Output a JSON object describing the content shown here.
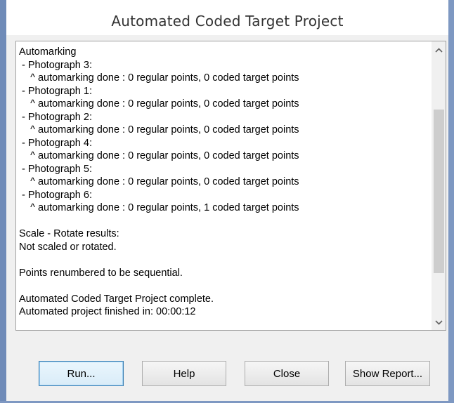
{
  "window": {
    "title": "Automated Coded Target Project"
  },
  "log": {
    "lines": [
      "Automarking",
      " - Photograph 3:",
      "    ^ automarking done : 0 regular points, 0 coded target points",
      " - Photograph 1:",
      "    ^ automarking done : 0 regular points, 0 coded target points",
      " - Photograph 2:",
      "    ^ automarking done : 0 regular points, 0 coded target points",
      " - Photograph 4:",
      "    ^ automarking done : 0 regular points, 0 coded target points",
      " - Photograph 5:",
      "    ^ automarking done : 0 regular points, 0 coded target points",
      " - Photograph 6:",
      "    ^ automarking done : 0 regular points, 1 coded target points",
      "",
      "Scale - Rotate results:",
      "Not scaled or rotated.",
      "",
      "Points renumbered to be sequential.",
      "",
      "Automated Coded Target Project complete.",
      "Automated project finished in: 00:00:12"
    ],
    "scroll_position": 0.55
  },
  "buttons": {
    "run": "Run...",
    "help": "Help",
    "close": "Close",
    "show_report": "Show Report..."
  },
  "icons": {
    "scroll_up": "chevron-up-icon",
    "scroll_down": "chevron-down-icon"
  },
  "colors": {
    "frame": "#6f8bb8",
    "dialog_background": "#f0f0f0",
    "default_button_border": "#3c7fb1"
  }
}
